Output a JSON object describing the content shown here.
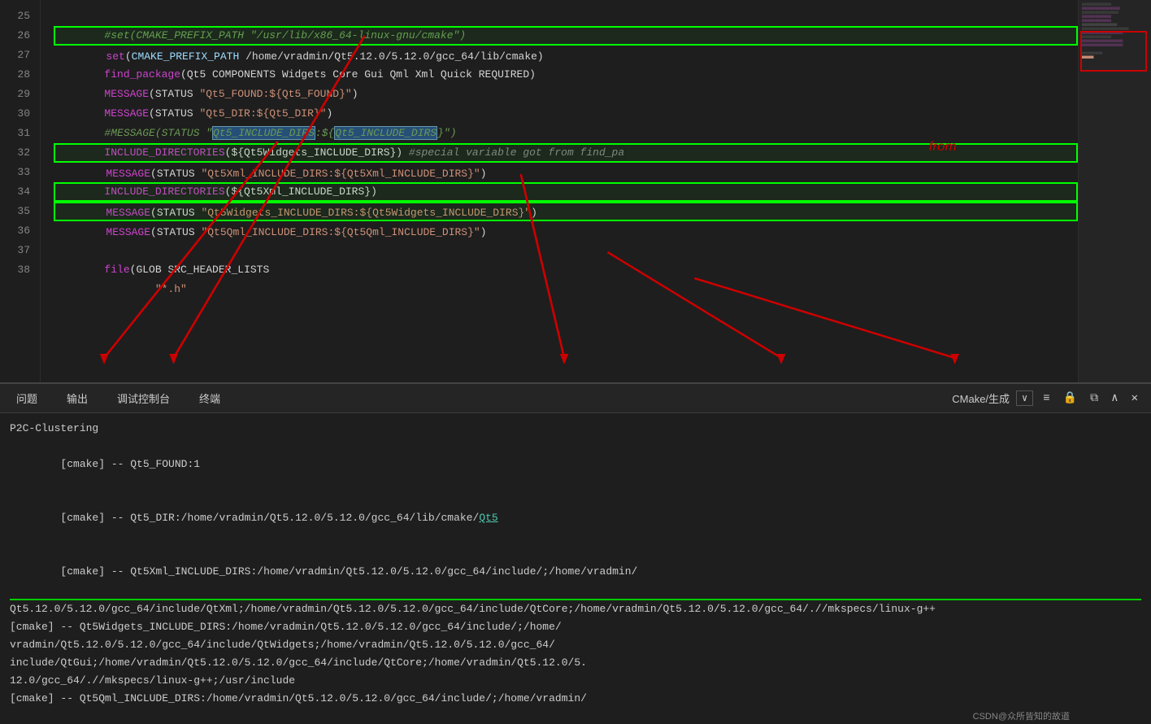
{
  "editor": {
    "lines": [
      {
        "number": "25",
        "content": "#set(CMAKE_PREFIX_PATH \"/usr/lib/x86_64-linux-gnu/cmake\")",
        "type": "comment",
        "highlight": false
      },
      {
        "number": "26",
        "content": "set(CMAKE_PREFIX_PATH /home/vradmin/Qt5.12.0/5.12.0/gcc_64/lib/cmake)",
        "type": "set-line",
        "highlight": true
      },
      {
        "number": "27",
        "content": "find_package(Qt5 COMPONENTS Widgets Core Gui Qml Xml Quick REQUIRED)",
        "type": "find-package",
        "highlight": false
      },
      {
        "number": "28",
        "content": "MESSAGE(STATUS \"Qt5_FOUND:${Qt5_FOUND}\")",
        "type": "message",
        "highlight": false
      },
      {
        "number": "29",
        "content": "MESSAGE(STATUS \"Qt5_DIR:${Qt5_DIR}\")",
        "type": "message",
        "highlight": false
      },
      {
        "number": "30",
        "content": "#MESSAGE(STATUS \"Qt5_INCLUDE_DIRS:${Qt5_INCLUDE_DIRS}\")",
        "type": "comment-message",
        "highlight": false
      },
      {
        "number": "31",
        "content": "INCLUDE_DIRECTORIES(${Qt5Widgets_INCLUDE_DIRS}) #special variable got from find_pa",
        "type": "include",
        "highlight": false
      },
      {
        "number": "32",
        "content": "MESSAGE(STATUS \"Qt5Xml_INCLUDE_DIRS:${Qt5Xml_INCLUDE_DIRS}\")",
        "type": "message",
        "highlight": true
      },
      {
        "number": "33",
        "content": "INCLUDE_DIRECTORIES(${Qt5Xml_INCLUDE_DIRS})",
        "type": "include",
        "highlight": false
      },
      {
        "number": "34",
        "content": "MESSAGE(STATUS \"Qt5Widgets_INCLUDE_DIRS:${Qt5Widgets_INCLUDE_DIRS}\")",
        "type": "message",
        "highlight": true
      },
      {
        "number": "35",
        "content": "MESSAGE(STATUS \"Qt5Qml_INCLUDE_DIRS:${Qt5Qml_INCLUDE_DIRS}\")",
        "type": "message",
        "highlight": true
      },
      {
        "number": "36",
        "content": "",
        "type": "empty",
        "highlight": false
      },
      {
        "number": "37",
        "content": "file(GLOB SRC_HEADER_LISTS",
        "type": "file",
        "highlight": false
      },
      {
        "number": "38",
        "content": "        \"*.h\"",
        "type": "string-line",
        "highlight": false
      }
    ]
  },
  "terminal": {
    "tabs": [
      {
        "label": "问题",
        "active": false
      },
      {
        "label": "输出",
        "active": false
      },
      {
        "label": "调试控制台",
        "active": false
      },
      {
        "label": "终端",
        "active": false
      }
    ],
    "title": "CMake/生成",
    "dropdown_label": "∨",
    "controls": [
      "≡",
      "🔒",
      "□",
      "∧",
      "✕"
    ],
    "output_lines": [
      "P2C-Clustering",
      "[cmake] -- Qt5_FOUND:1",
      "[cmake] -- Qt5_DIR:/home/vradmin/Qt5.12.0/5.12.0/gcc_64/lib/cmake/Qt5",
      "[cmake] -- Qt5Xml_INCLUDE_DIRS:/home/vradmin/Qt5.12.0/5.12.0/gcc_64/include/;/home/vradmin/Qt5.12.0/5.12.0/gcc_64/include/QtXml;/home/vradmin/Qt5.12.0/5.12.0/gcc_64/include/QtCore;/home/vradmin/Qt5.12.0/5.12.0/gcc_64/.//mkspecs/linux-g++",
      "[cmake] -- Qt5Widgets_INCLUDE_DIRS:/home/vradmin/Qt5.12.0/5.12.0/gcc_64/include/;/home/vradmin/Qt5.12.0/5.12.0/gcc_64/include/QtWidgets;/home/vradmin/Qt5.12.0/5.12.0/gcc_64/include/QtGui;/home/vradmin/Qt5.12.0/5.12.0/gcc_64/include/QtCore;/home/vradmin/Qt5.12.0/5.12.0/gcc_64/.//mkspecs/linux-g++;/usr/include",
      "[cmake] -- Qt5Qml_INCLUDE_DIRS:/home/vradmin/Qt5.12.0/5.12.0/gcc_64/include/;/home/vradmin/"
    ]
  },
  "watermark": "CSDN@众所皆知的故道",
  "annotations": {
    "from_label": "from"
  }
}
